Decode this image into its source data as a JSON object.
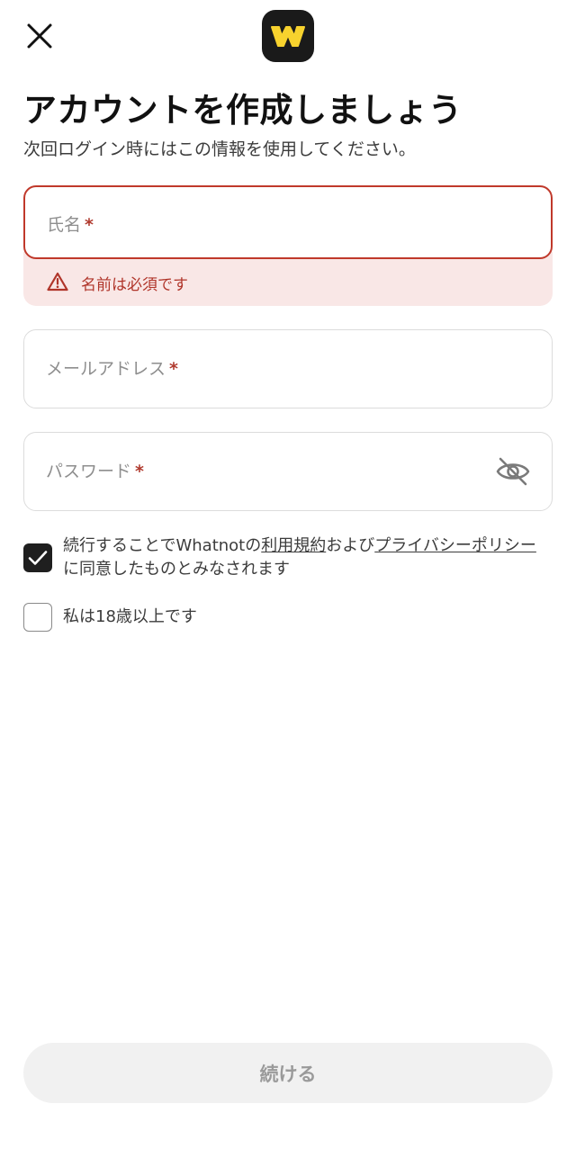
{
  "header": {
    "close_icon": "close-icon",
    "logo_icon": "whatnot-logo-icon",
    "logo_letter": "W",
    "logo_colors": {
      "background": "#1a1a1a",
      "foreground": "#f7d22e"
    }
  },
  "title": "アカウントを作成しましょう",
  "subtitle": "次回ログイン時にはこの情報を使用してください。",
  "form": {
    "name": {
      "label": "氏名",
      "required_mark": "*",
      "state": "error",
      "error_icon": "warning-triangle-icon",
      "error_text": "名前は必須です"
    },
    "email": {
      "label": "メールアドレス",
      "required_mark": "*"
    },
    "password": {
      "label": "パスワード",
      "required_mark": "*",
      "toggle_icon": "eye-off-icon"
    }
  },
  "consent": {
    "checked": true,
    "text_before": "続行することでWhatnotの",
    "terms_link": "利用規約",
    "text_middle": "および",
    "privacy_link": "プライバシーポリシー",
    "text_after": "に同意したものとみなされます"
  },
  "age": {
    "checked": false,
    "text": "私は18歳以上です"
  },
  "continue_button": "続ける",
  "colors": {
    "error": "#c0392b",
    "error_background": "#f9e7e6",
    "checkbox_checked": "#1f1f1f",
    "button_disabled_background": "#f1f1f1",
    "button_disabled_text": "#9a9a9a"
  }
}
